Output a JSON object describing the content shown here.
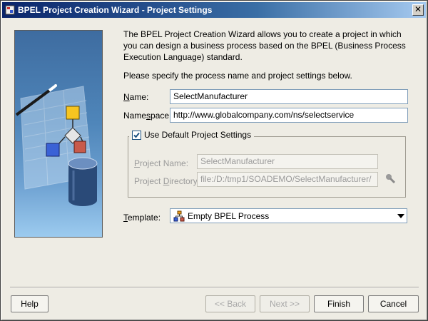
{
  "window": {
    "title": "BPEL Project Creation Wizard - Project Settings",
    "close_glyph": "✕"
  },
  "intro_text": "The BPEL Project Creation Wizard allows you to create a project in which you can design a business process based on the BPEL (Business Process Execution Language) standard.",
  "instruction": "Please specify the process name and project settings below.",
  "form": {
    "name_label_underlined": "N",
    "name_label_rest": "ame:",
    "name_value": "SelectManufacturer",
    "namespace_label_start": "Name",
    "namespace_label_underlined": "s",
    "namespace_label_rest": "pace:",
    "namespace_value": "http://www.globalcompany.com/ns/selectservice"
  },
  "defaults_group": {
    "checkbox_label": "Use Default Project Settings",
    "checked": true,
    "project_name_label_underlined": "P",
    "project_name_label_rest": "roject Name:",
    "project_name_value": "SelectManufacturer",
    "project_dir_label_start": "Project ",
    "project_dir_label_underlined": "D",
    "project_dir_label_rest": "irectory:",
    "project_dir_value": "file:/D:/tmp1/SOADEMO/SelectManufacturer/"
  },
  "template": {
    "label_underlined": "T",
    "label_rest": "emplate:",
    "selected": "Empty BPEL Process"
  },
  "buttons": {
    "help": "Help",
    "back": "<< Back",
    "next": "Next >>",
    "finish": "Finish",
    "cancel": "Cancel"
  },
  "colors": {
    "titlebar_start": "#0a246a",
    "banner_blue": "#4f86ba",
    "checkbox_check": "#1c5180"
  }
}
